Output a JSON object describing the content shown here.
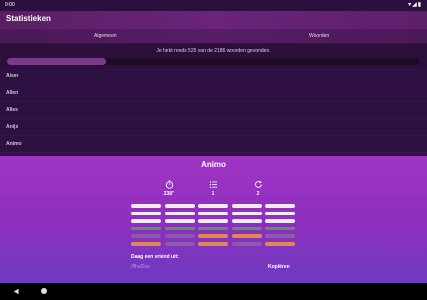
{
  "status_bar": {
    "time": "9:00",
    "icons": "▾◢▮"
  },
  "app_bar": {
    "title": "Statistieken"
  },
  "tabs": [
    {
      "label": "Algemeen"
    },
    {
      "label": "Woorden"
    }
  ],
  "overview": {
    "summary": "Je hebt reeds 525 van de 2186 woorden gevonden.",
    "progress_fraction": 0.24
  },
  "word_list": [
    {
      "label": "Aiser"
    },
    {
      "label": "Allen"
    },
    {
      "label": "Alles"
    },
    {
      "label": "Anijs"
    },
    {
      "label": "Animo"
    }
  ],
  "detail": {
    "word": "Animo",
    "time": "238\"",
    "guesses": "1",
    "tries": "2",
    "share_label": "Daag een vriend uit:",
    "share_link": "/ffhaDue",
    "copy_label": "Kopiëren"
  },
  "colors": {
    "white": "#f1ecf4",
    "green": "#5f8f6a",
    "orange": "#e08a4f",
    "grey": "#8b5aa8"
  },
  "result_grid": [
    [
      "white",
      "white",
      "white",
      "white",
      "white"
    ],
    [
      "white",
      "white",
      "white",
      "white",
      "white"
    ],
    [
      "white",
      "white",
      "white",
      "white",
      "white"
    ],
    [
      "green",
      "green",
      "green",
      "green",
      "green"
    ],
    [
      "grey",
      "grey",
      "orange",
      "orange",
      "grey"
    ],
    [
      "orange",
      "grey",
      "orange",
      "grey",
      "orange"
    ]
  ]
}
